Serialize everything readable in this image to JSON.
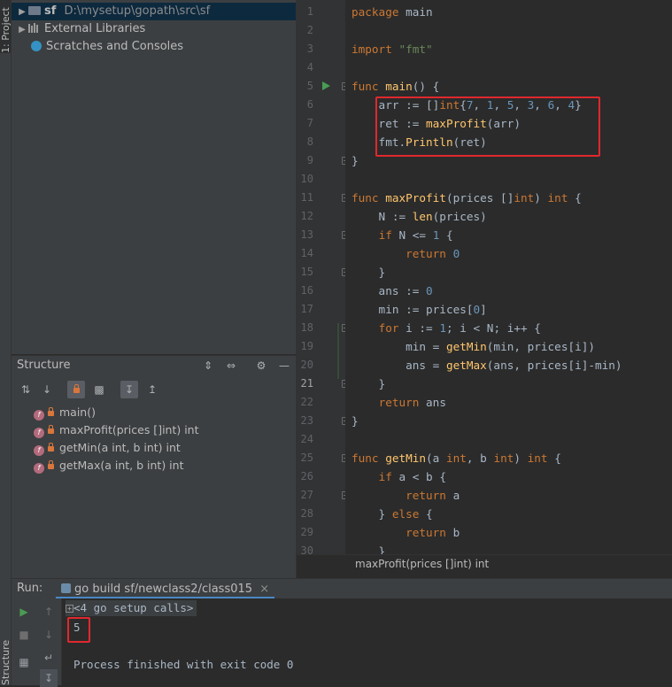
{
  "sidebar": {
    "project_tab": "1: Project",
    "structure_tab": "Structure"
  },
  "project": {
    "root_name": "sf",
    "root_path": "D:\\mysetup\\gopath\\src\\sf",
    "external_libraries": "External Libraries",
    "scratches": "Scratches and Consoles"
  },
  "structure": {
    "title": "Structure",
    "items": [
      "main()",
      "maxProfit(prices []int) int",
      "getMin(a int, b int) int",
      "getMax(a int, b int) int"
    ]
  },
  "editor": {
    "line_numbers": [
      "1",
      "2",
      "3",
      "4",
      "5",
      "6",
      "7",
      "8",
      "9",
      "10",
      "11",
      "12",
      "13",
      "14",
      "15",
      "16",
      "17",
      "18",
      "19",
      "20",
      "21",
      "22",
      "23",
      "24",
      "25",
      "26",
      "27",
      "28",
      "29",
      "30"
    ],
    "current_line": "21",
    "lines": [
      "package main",
      "",
      "import \"fmt\"",
      "",
      "func main() {",
      "    arr := []int{7, 1, 5, 3, 6, 4}",
      "    ret := maxProfit(arr)",
      "    fmt.Println(ret)",
      "}",
      "",
      "func maxProfit(prices []int) int {",
      "    N := len(prices)",
      "    if N <= 1 {",
      "        return 0",
      "    }",
      "    ans := 0",
      "    min := prices[0]",
      "    for i := 1; i < N; i++ {",
      "        min = getMin(min, prices[i])",
      "        ans = getMax(ans, prices[i]-min)",
      "    }",
      "    return ans",
      "}",
      "",
      "func getMin(a int, b int) int {",
      "    if a < b {",
      "        return a",
      "    } else {",
      "        return b",
      "    }"
    ],
    "breadcrumb": "maxProfit(prices []int) int"
  },
  "run": {
    "label": "Run:",
    "tab_title": "go build sf/newclass2/class015",
    "collapsed": "<4 go setup calls>",
    "output": "5",
    "finished": "Process finished with exit code 0"
  },
  "colors": {
    "highlight_box": "#e0282e",
    "keyword": "#cc7832",
    "number": "#6897bb",
    "string": "#6a8759",
    "function": "#ffc66d"
  }
}
